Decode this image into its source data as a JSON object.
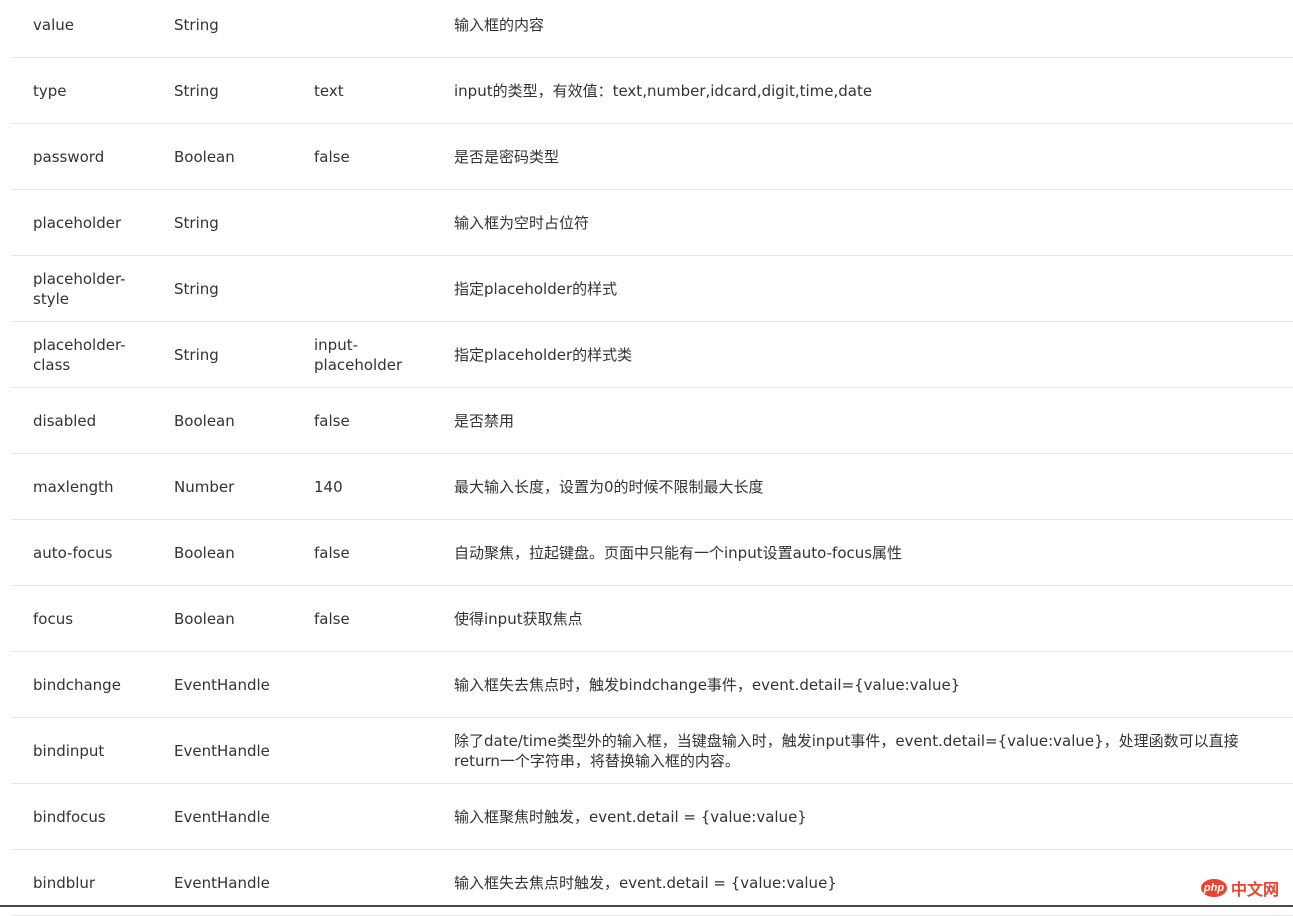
{
  "rows": [
    {
      "name": "value",
      "type": "String",
      "default": "",
      "desc": "输入框的内容"
    },
    {
      "name": "type",
      "type": "String",
      "default": "text",
      "desc": "input的类型，有效值：text,number,idcard,digit,time,date"
    },
    {
      "name": "password",
      "type": "Boolean",
      "default": "false",
      "desc": "是否是密码类型"
    },
    {
      "name": "placeholder",
      "type": "String",
      "default": "",
      "desc": "输入框为空时占位符"
    },
    {
      "name": "placeholder-\nstyle",
      "type": "String",
      "default": "",
      "desc": "指定placeholder的样式"
    },
    {
      "name": "placeholder-\nclass",
      "type": "String",
      "default": "input-\nplaceholder",
      "desc": "指定placeholder的样式类"
    },
    {
      "name": "disabled",
      "type": "Boolean",
      "default": "false",
      "desc": "是否禁用"
    },
    {
      "name": "maxlength",
      "type": "Number",
      "default": "140",
      "desc": "最大输入长度，设置为0的时候不限制最大长度"
    },
    {
      "name": "auto-focus",
      "type": "Boolean",
      "default": "false",
      "desc": "自动聚焦，拉起键盘。页面中只能有一个input设置auto-focus属性"
    },
    {
      "name": "focus",
      "type": "Boolean",
      "default": "false",
      "desc": "使得input获取焦点"
    },
    {
      "name": "bindchange",
      "type": "EventHandle",
      "default": "",
      "desc": "输入框失去焦点时，触发bindchange事件，event.detail={value:value}"
    },
    {
      "name": "bindinput",
      "type": "EventHandle",
      "default": "",
      "desc": "除了date/time类型外的输入框，当键盘输入时，触发input事件，event.detail={value:value}，处理函数可以直接\nreturn一个字符串，将替换输入框的内容。"
    },
    {
      "name": "bindfocus",
      "type": "EventHandle",
      "default": "",
      "desc": "输入框聚焦时触发，event.detail = {value:value}"
    },
    {
      "name": "bindblur",
      "type": "EventHandle",
      "default": "",
      "desc": "输入框失去焦点时触发，event.detail = {value:value}"
    }
  ],
  "watermark": {
    "logo_text": "php",
    "site_text": "中文网",
    "color": "#e8452c"
  }
}
